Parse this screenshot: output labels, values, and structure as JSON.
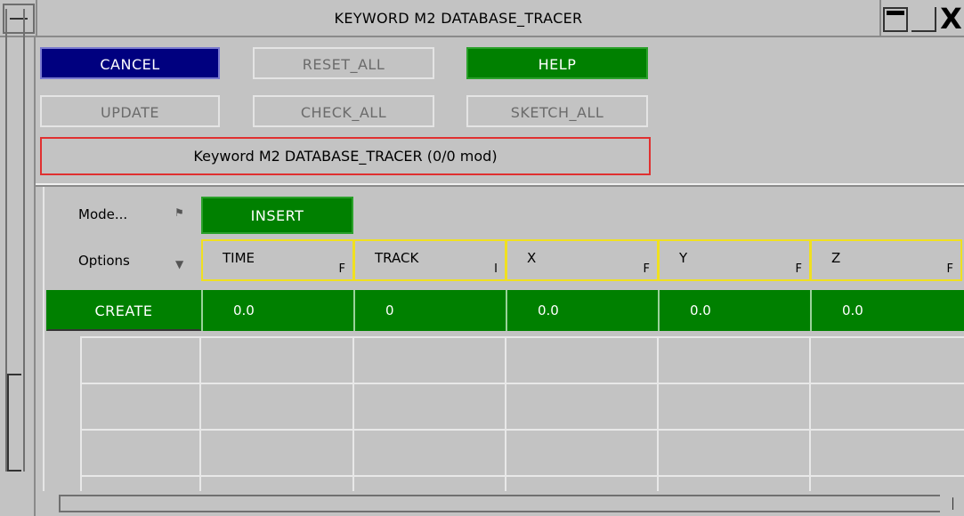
{
  "window": {
    "title": "KEYWORD M2 DATABASE_TRACER",
    "close_glyph": "X"
  },
  "toolbar": {
    "cancel": "CANCEL",
    "reset_all": "RESET_ALL",
    "help": "HELP",
    "update": "UPDATE",
    "check_all": "CHECK_ALL",
    "sketch_all": "SKETCH_ALL"
  },
  "status": "Keyword M2 DATABASE_TRACER (0/0 mod)",
  "mode": {
    "label": "Mode...",
    "value": "INSERT"
  },
  "options": {
    "label": "Options"
  },
  "columns": [
    {
      "name": "TIME",
      "type": "F"
    },
    {
      "name": "TRACK",
      "type": "I"
    },
    {
      "name": "X",
      "type": "F"
    },
    {
      "name": "Y",
      "type": "F"
    },
    {
      "name": "Z",
      "type": "F"
    }
  ],
  "create_label": "CREATE",
  "values": [
    "0.0",
    "0",
    "0.0",
    "0.0",
    "0.0"
  ],
  "icons": {
    "mode_flag": "flag-icon",
    "options_arrow": "down-arrow-icon",
    "minimize": "minimize-icon",
    "maximize": "maximize-icon",
    "close": "close-icon"
  },
  "colors": {
    "background": "#c3c3c3",
    "blue_button": "#00007f",
    "green_button": "#008000",
    "status_border": "#e03030",
    "header_border": "#f0e020"
  }
}
